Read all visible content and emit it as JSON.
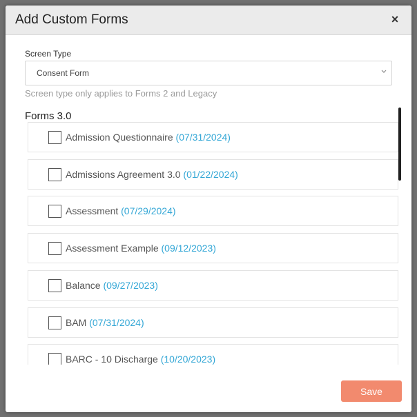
{
  "modal": {
    "title": "Add Custom Forms",
    "close_glyph": "×"
  },
  "screen_type": {
    "label": "Screen Type",
    "selected": "Consent Form",
    "hint": "Screen type only applies to Forms 2 and Legacy"
  },
  "forms_section": {
    "title": "Forms 3.0",
    "items": [
      {
        "name": "Admission Questionnaire",
        "date": "(07/31/2024)"
      },
      {
        "name": "Admissions Agreement 3.0",
        "date": "(01/22/2024)"
      },
      {
        "name": "Assessment",
        "date": "(07/29/2024)"
      },
      {
        "name": "Assessment Example",
        "date": "(09/12/2023)"
      },
      {
        "name": "Balance",
        "date": "(09/27/2023)"
      },
      {
        "name": "BAM",
        "date": "(07/31/2024)"
      },
      {
        "name": "BARC - 10 Discharge",
        "date": "(10/20/2023)"
      }
    ]
  },
  "footer": {
    "save_label": "Save"
  },
  "colors": {
    "accent_date": "#34a7d6",
    "save_button": "#f28a6e",
    "overlay": "#6f6f6f"
  },
  "icons": [
    "close-icon",
    "chevron-down-icon",
    "checkbox-icon"
  ]
}
